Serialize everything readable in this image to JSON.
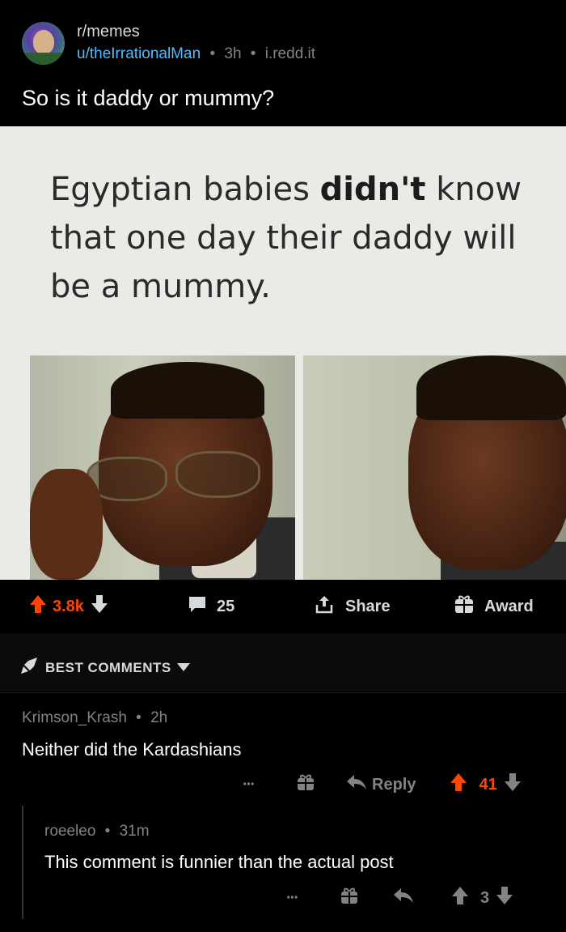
{
  "post": {
    "subreddit": "r/memes",
    "author": "u/theIrrationalMan",
    "time": "3h",
    "domain": "i.redd.it",
    "separator": "•",
    "title": "So is it daddy or mummy?"
  },
  "meme": {
    "line_1a": "Egyptian babies ",
    "line_1b": "didn't",
    "line_1c": " know",
    "line_2": "that one day their daddy will",
    "line_3": "be a mummy."
  },
  "actions": {
    "score": "3.8k",
    "comments": "25",
    "share_label": "Share",
    "award_label": "Award"
  },
  "comments_header": {
    "sort_label": "BEST COMMENTS"
  },
  "comments": [
    {
      "author": "Krimson_Krash",
      "time": "2h",
      "body": "Neither did the Kardashians",
      "reply_label": "Reply",
      "score": "41",
      "more": "···"
    },
    {
      "author": "roeeleo",
      "time": "31m",
      "body": "This comment is funnier than the actual post",
      "score": "3",
      "more": "···"
    }
  ],
  "colors": {
    "upvote": "#ff4500",
    "link": "#4fbcff",
    "muted": "#818384"
  },
  "icons": [
    "upvote-icon",
    "downvote-icon",
    "comment-icon",
    "share-icon",
    "award-icon",
    "rocket-icon",
    "chevron-down-icon",
    "reply-icon",
    "gift-icon",
    "more-icon"
  ]
}
